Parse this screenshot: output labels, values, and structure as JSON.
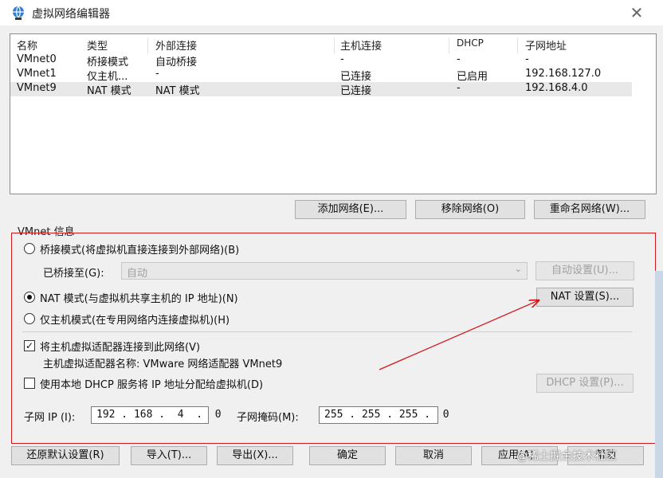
{
  "window": {
    "title": "虚拟网络编辑器",
    "close_symbol": "✕"
  },
  "list": {
    "headers": [
      "名称",
      "类型",
      "外部连接",
      "主机连接",
      "DHCP",
      "子网地址"
    ],
    "rows": [
      [
        "VMnet0",
        "桥接模式",
        "自动桥接",
        "-",
        "-",
        "-"
      ],
      [
        "VMnet1",
        "仅主机...",
        "-",
        "已连接",
        "已启用",
        "192.168.127.0"
      ],
      [
        "VMnet9",
        "NAT 模式",
        "NAT 模式",
        "已连接",
        "-",
        "192.168.4.0"
      ]
    ],
    "selected_row": 2
  },
  "list_buttons": {
    "add": "添加网络(E)...",
    "remove": "移除网络(O)",
    "rename": "重命名网络(W)..."
  },
  "vmnet_info": {
    "group_label": "VMnet 信息",
    "bridged_radio": "桥接模式(将虚拟机直接连接到外部网络)(B)",
    "bridged_to_label": "已桥接至(G):",
    "bridged_to_value": "自动",
    "auto_settings": "自动设置(U)...",
    "nat_radio": "NAT 模式(与虚拟机共享主机的 IP 地址)(N)",
    "nat_settings": "NAT 设置(S)...",
    "hostonly_radio": "仅主机模式(在专用网络内连接虚拟机)(H)",
    "connect_adapter_check": "将主机虚拟适配器连接到此网络(V)",
    "adapter_name_text": "主机虚拟适配器名称: VMware 网络适配器 VMnet9",
    "dhcp_check": "使用本地 DHCP 服务将 IP 地址分配给虚拟机(D)",
    "dhcp_settings": "DHCP 设置(P)...",
    "subnet_ip_label": "子网 IP (I):",
    "subnet_ip_value": "192 . 168 .  4  .  0",
    "subnet_mask_label": "子网掩码(M):",
    "subnet_mask_value": "255 . 255 . 255 .  0",
    "selected_mode": "nat",
    "connect_adapter_checked": true,
    "dhcp_checked": false
  },
  "footer_buttons": {
    "restore": "还原默认设置(R)",
    "import": "导入(T)...",
    "export": "导出(X)...",
    "ok": "确定",
    "cancel": "取消",
    "apply": "应用(A)",
    "help": "帮助"
  },
  "watermark": "@稀土掘金技术社区",
  "colors": {
    "highlight_box": "#d0181f",
    "arrow": "#d0181f"
  },
  "icons": {
    "app": "network-globe-icon",
    "close": "close-icon",
    "combo": "chevron-down-icon"
  }
}
